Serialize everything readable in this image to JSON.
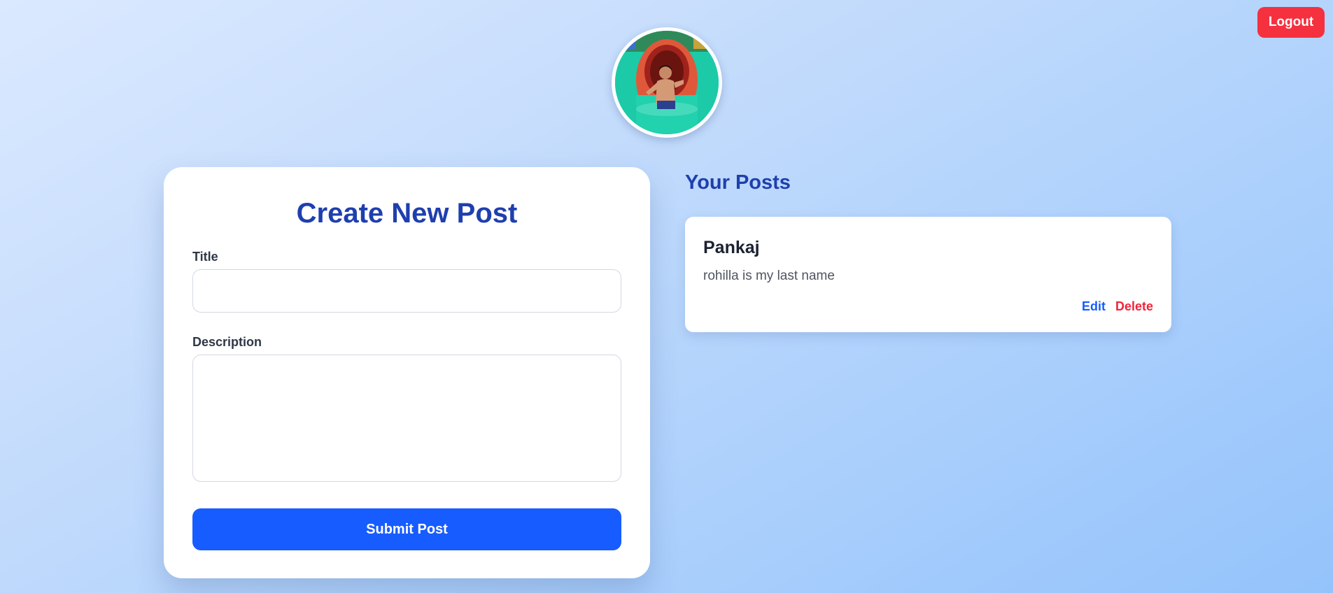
{
  "header": {
    "logout_label": "Logout"
  },
  "profile": {
    "avatar_icon": "profile-photo"
  },
  "create_post": {
    "heading": "Create New Post",
    "title_label": "Title",
    "title_value": "",
    "description_label": "Description",
    "description_value": "",
    "submit_label": "Submit Post"
  },
  "posts": {
    "heading": "Your Posts",
    "items": [
      {
        "title": "Pankaj",
        "description": "rohilla is my last name",
        "edit_label": "Edit",
        "delete_label": "Delete"
      }
    ]
  },
  "colors": {
    "accent": "#175cff",
    "heading": "#1e3fae",
    "danger": "#f5313f"
  }
}
